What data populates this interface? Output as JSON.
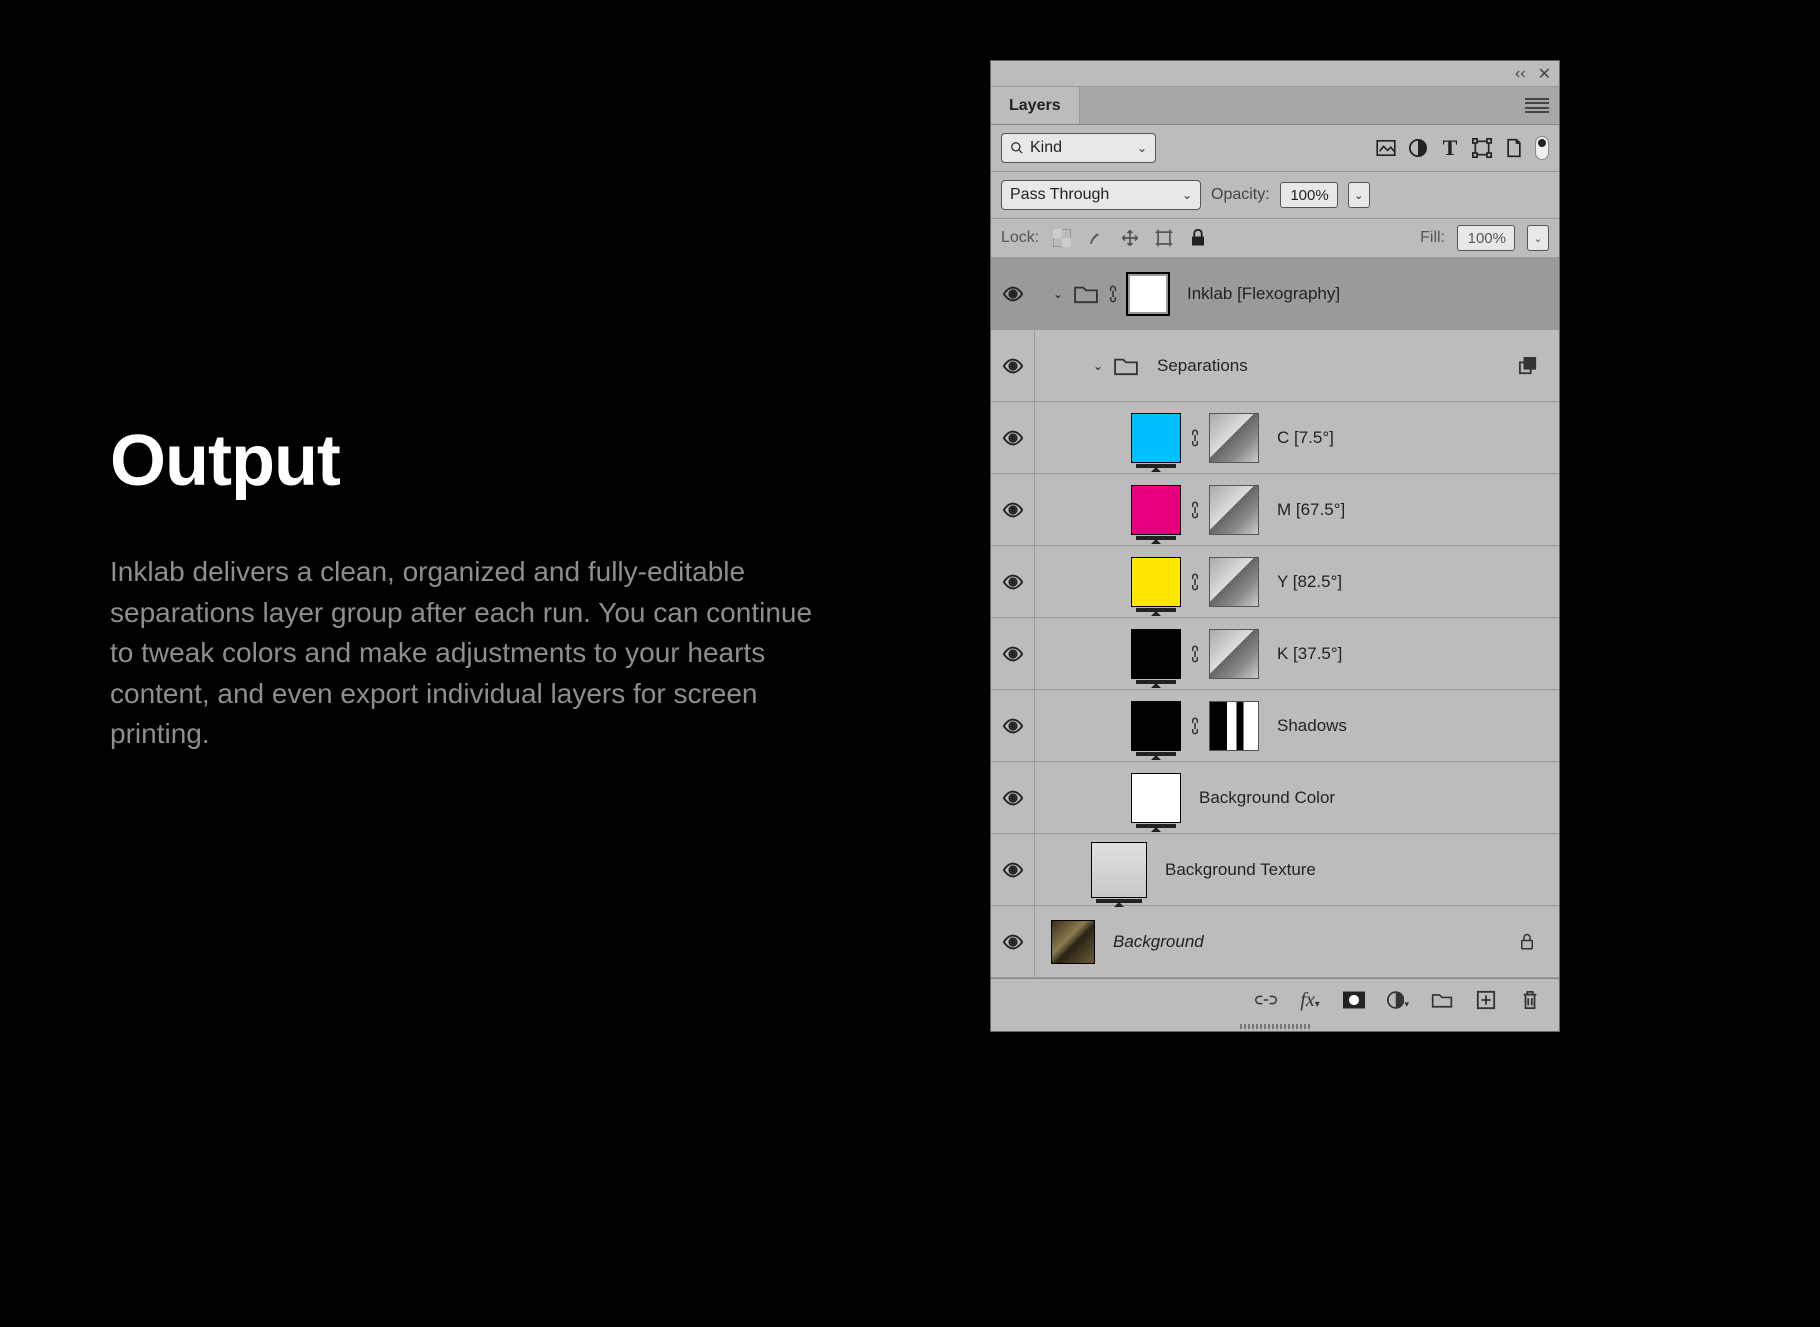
{
  "marketing": {
    "title": "Output",
    "body": "Inklab delivers a clean, organized and fully-editable separations layer group after each run. You can continue to tweak colors and make adjustments to your hearts content, and even export individual layers for screen printing."
  },
  "panel": {
    "tab": "Layers",
    "filter_label": "Kind",
    "blend_mode": "Pass Through",
    "opacity_label": "Opacity:",
    "opacity_value": "100%",
    "lock_label": "Lock:",
    "fill_label": "Fill:",
    "fill_value": "100%"
  },
  "layers": [
    {
      "name": "Inklab [Flexography]",
      "depth": 0,
      "type": "group",
      "expanded": true,
      "selected": true,
      "linked": true,
      "thumb": "white-corners"
    },
    {
      "name": "Separations",
      "depth": 1,
      "type": "group",
      "expanded": true,
      "extra": "clip"
    },
    {
      "name": "C [7.5°]",
      "depth": 2,
      "type": "layer",
      "swatch": "#00BFFF",
      "linked": true,
      "mask": true
    },
    {
      "name": "M [67.5°]",
      "depth": 2,
      "type": "layer",
      "swatch": "#E6007E",
      "linked": true,
      "mask": true
    },
    {
      "name": "Y [82.5°]",
      "depth": 2,
      "type": "layer",
      "swatch": "#FFE600",
      "linked": true,
      "mask": true
    },
    {
      "name": "K [37.5°]",
      "depth": 2,
      "type": "layer",
      "swatch": "#000000",
      "linked": true,
      "mask": true
    },
    {
      "name": "Shadows",
      "depth": 2,
      "type": "layer",
      "swatch": "#000000",
      "linked": true,
      "mask": true,
      "mask_variant": "bw"
    },
    {
      "name": "Background Color",
      "depth": 2,
      "type": "layer",
      "swatch": "#FFFFFF"
    },
    {
      "name": "Background Texture",
      "depth": 1,
      "type": "layer",
      "thumb": "texture"
    },
    {
      "name": "Background",
      "depth": 0,
      "type": "layer",
      "thumb": "photo",
      "italic": true,
      "locked": true
    }
  ]
}
